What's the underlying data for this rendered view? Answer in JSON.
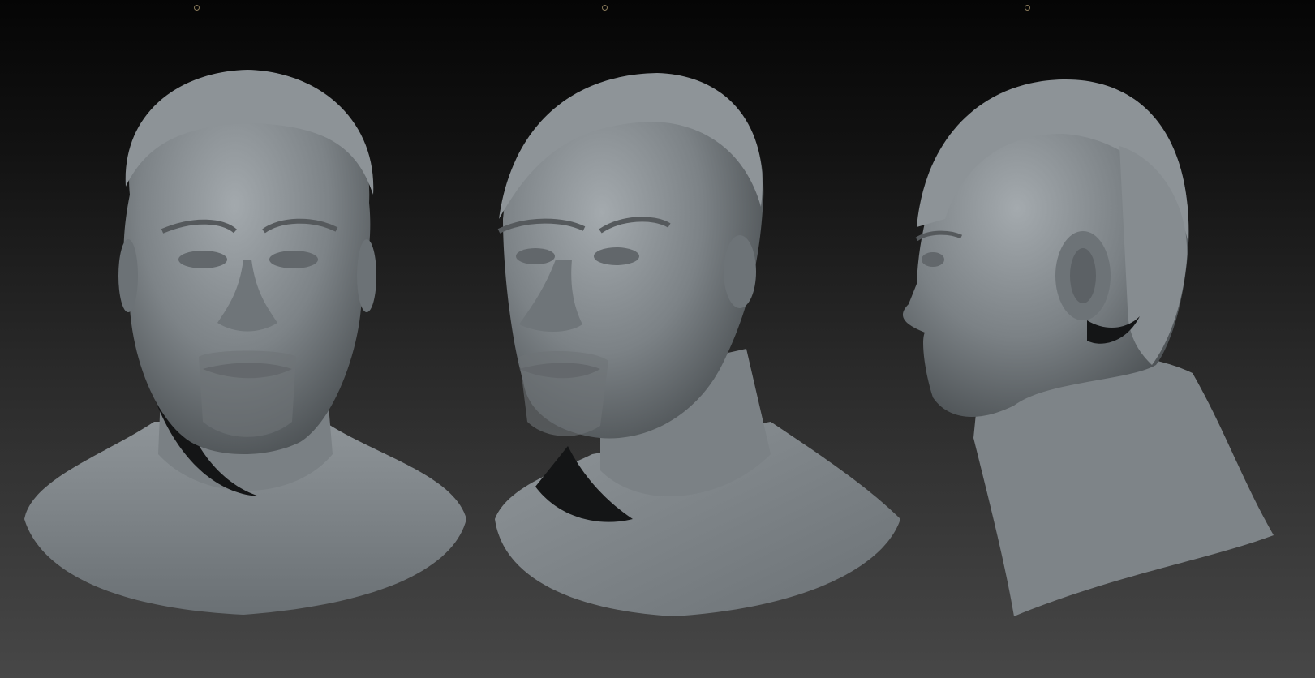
{
  "scene": {
    "background_top": "#050505",
    "background_bottom": "#474747",
    "material_color": "#7c8286",
    "material_highlight": "#a6acb0",
    "material_shadow": "#3a3e41",
    "views": [
      {
        "name": "front",
        "description_icon": "bust-front"
      },
      {
        "name": "three-quarter",
        "description_icon": "bust-three-quarter"
      },
      {
        "name": "side",
        "description_icon": "bust-profile"
      }
    ]
  }
}
